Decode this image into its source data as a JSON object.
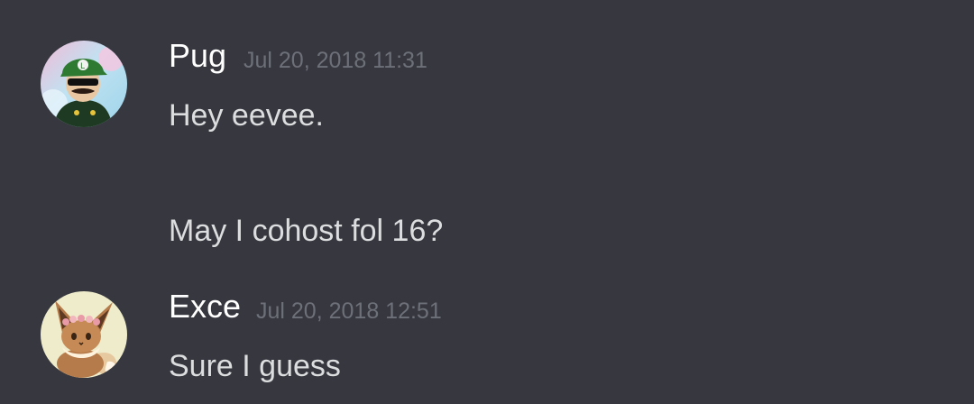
{
  "messages": [
    {
      "author": "Pug",
      "timestamp": "Jul 20, 2018 11:31",
      "avatar_icon": "luigi-avatar-icon",
      "lines": [
        "Hey eevee.",
        "May I cohost fol 16?"
      ]
    },
    {
      "author": "Exce",
      "timestamp": "Jul 20, 2018 12:51",
      "avatar_icon": "eevee-avatar-icon",
      "lines": [
        "Sure I guess"
      ]
    }
  ],
  "colors": {
    "background": "#36373f",
    "username": "#ffffff",
    "message_text": "#dcddde",
    "timestamp": "#6e7079"
  }
}
